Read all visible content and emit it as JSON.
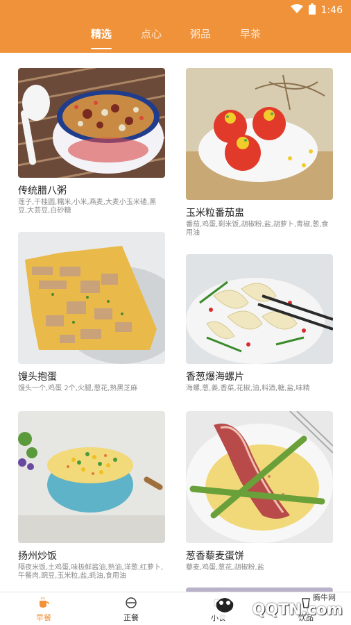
{
  "status": {
    "time": "1:46"
  },
  "tabs": [
    {
      "label": "精选",
      "active": true
    },
    {
      "label": "点心",
      "active": false
    },
    {
      "label": "粥品",
      "active": false
    },
    {
      "label": "早茶",
      "active": false
    }
  ],
  "recipes": [
    {
      "title": "传统腊八粥",
      "ingredients": "莲子,干桂圆,糯米,小米,燕麦,大麦小玉米碴,黑豆,大芸豆,白砂糖"
    },
    {
      "title": "玉米粒番茄盅",
      "ingredients": "番茄,鸡蛋,剩米饭,胡椒粉,盐,胡萝卜,青椒,葱,食用油"
    },
    {
      "title": "馒头抱蛋",
      "ingredients": "馒头一个,鸡蛋 2个,火腿,葱花,熟黑芝麻"
    },
    {
      "title": "香葱爆海螺片",
      "ingredients": "海螺,葱,姜,香菜,花椒,油,料酒,糖,盐,味精"
    },
    {
      "title": "扬州炒饭",
      "ingredients": "隔夜米饭,土鸡蛋,味极鲜酱油,熟油,洋葱,红萝卜,午餐肉,豌豆,玉米粒,盐,蚝油,食用油"
    },
    {
      "title": "葱香藜麦蛋饼",
      "ingredients": "藜麦,鸡蛋,葱花,胡椒粉,盐"
    }
  ],
  "bottom_nav": [
    {
      "label": "早餐",
      "active": true,
      "icon": "coffee-cup-icon"
    },
    {
      "label": "正餐",
      "active": false,
      "icon": "bowl-icon"
    },
    {
      "label": "小食",
      "active": false,
      "icon": "snack-icon"
    },
    {
      "label": "饮品",
      "active": false,
      "icon": "drink-icon"
    }
  ],
  "watermark": {
    "text1": "腾牛网",
    "text2": "QQTN.com"
  }
}
